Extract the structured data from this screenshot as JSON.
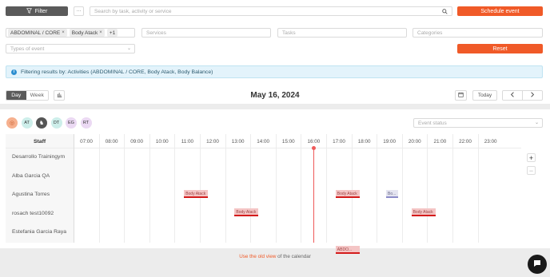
{
  "toolbar": {
    "filter_label": "Filter",
    "more_label": "···",
    "search_placeholder": "Search by task, activity or service",
    "schedule_label": "Schedule event"
  },
  "filters": {
    "chips": [
      "ABDOMINAL / CORE",
      "Body Atack"
    ],
    "chip_more": "+1",
    "services_placeholder": "Services",
    "tasks_placeholder": "Tasks",
    "categories_placeholder": "Categories",
    "types_placeholder": "Types of event",
    "reset_label": "Reset"
  },
  "info": {
    "text": "Filtering results by: Activities (ABDOMINAL / CORE, Body Atack, Body Balance)"
  },
  "view": {
    "day_label": "Day",
    "week_label": "Week",
    "date_label": "May 16, 2024",
    "today_label": "Today"
  },
  "calendar": {
    "avatars": [
      {
        "initials": "",
        "color": "#f6b08e",
        "icon": "fingerprint-icon"
      },
      {
        "initials": "AT",
        "color": "#cdeeea",
        "icon": ""
      },
      {
        "initials": "",
        "color": "#555555",
        "icon": "horse-icon"
      },
      {
        "initials": "DT",
        "color": "#cdeeea",
        "icon": ""
      },
      {
        "initials": "EG",
        "color": "#ebd9f3",
        "icon": ""
      },
      {
        "initials": "RT",
        "color": "#ebd9f3",
        "icon": ""
      }
    ],
    "status_placeholder": "Event status",
    "staff_header": "Staff",
    "hours": [
      "07:00",
      "08:00",
      "09:00",
      "10:00",
      "11:00",
      "12:00",
      "13:00",
      "14:00",
      "15:00",
      "16:00",
      "17:00",
      "18:00",
      "19:00",
      "20:00",
      "21:00",
      "22:00",
      "23:00"
    ],
    "staff": [
      "Desarrollo Trainingym",
      "Alba Garcia QA",
      "Agustina Torres",
      "rosach test10092",
      "Estefania Garcia Raya"
    ],
    "events": [
      {
        "staff": 1,
        "start": "11:00",
        "label": "Body Atack",
        "style": "red"
      },
      {
        "staff": 1,
        "start": "17:00",
        "label": "Body Atack",
        "style": "red"
      },
      {
        "staff": 1,
        "start": "19:00",
        "label": "Bo...",
        "style": "grey"
      },
      {
        "staff": 2,
        "start": "13:00",
        "label": "Body Atack",
        "style": "red"
      },
      {
        "staff": 2,
        "start": "20:00",
        "label": "Body Atack",
        "style": "red"
      },
      {
        "staff": 4,
        "start": "17:00",
        "label": "ABDO...",
        "style": "red"
      }
    ],
    "now": "16:30"
  },
  "footer": {
    "link_label": "Use the old view",
    "suffix": " of the calendar"
  },
  "colors": {
    "accent": "#f05a28",
    "dark_button": "#5a5a5a"
  }
}
